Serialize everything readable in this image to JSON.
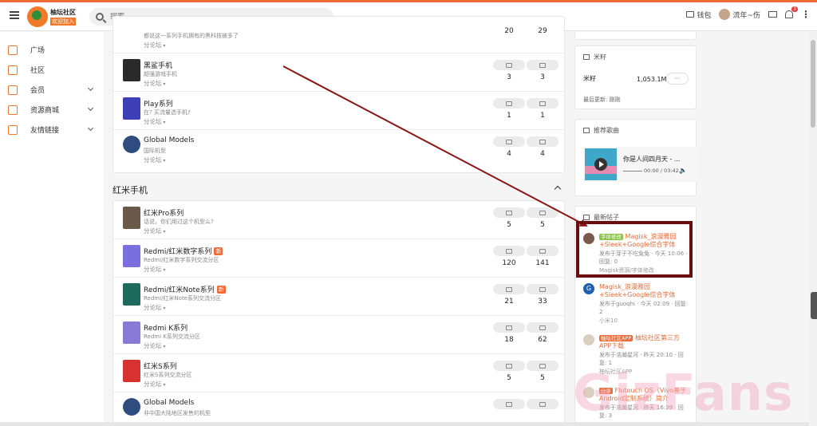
{
  "header": {
    "logo_title": "柚坛社区",
    "logo_sub": "欢迎加入",
    "search_placeholder": "搜索...",
    "wallet_label": "钱包",
    "user_name": "流年~伤",
    "bell_count": "3"
  },
  "sidebar": {
    "items": [
      {
        "label": "广场"
      },
      {
        "label": "社区"
      },
      {
        "label": "会员"
      },
      {
        "label": "资源商城"
      },
      {
        "label": "友情链接"
      }
    ]
  },
  "black_shark_section": {
    "top_partial": {
      "desc": "都说这一系列手机拥有的黑科技被多了",
      "sub": "分论坛",
      "topics": "20",
      "posts": "29"
    },
    "rows": [
      {
        "title": "黑鲨手机",
        "desc": "超强游戏手机",
        "sub": "分论坛",
        "topics": "3",
        "posts": "3",
        "thumb_color": "#2a2a2a"
      },
      {
        "title": "Play系列",
        "desc": "在? 买流量选手机?",
        "sub": "分论坛",
        "topics": "1",
        "posts": "1",
        "thumb_color": "#3d3fb8"
      },
      {
        "title": "Global Models",
        "desc": "国际机型",
        "sub": "分论坛",
        "topics": "4",
        "posts": "4",
        "thumb_color": "#2f4c80"
      }
    ]
  },
  "redmi_section": {
    "title": "红米手机",
    "rows": [
      {
        "title": "红米Pro系列",
        "new": "",
        "desc": "话说，你们用过这个机型么?",
        "sub": "分论坛",
        "topics": "5",
        "posts": "5",
        "thumb_color": "#6b5a4a"
      },
      {
        "title": "Redmi/红米数字系列",
        "new": "新",
        "desc": "Redmi/红米数字系列交流分区",
        "sub": "分论坛",
        "topics": "120",
        "posts": "141",
        "thumb_color": "#7b6fe0"
      },
      {
        "title": "Redmi/红米Note系列",
        "new": "新",
        "desc": "Redmi/红米Note系列交流分区",
        "sub": "分论坛",
        "topics": "21",
        "posts": "33",
        "thumb_color": "#1e6a5c"
      },
      {
        "title": "Redmi K系列",
        "new": "",
        "desc": "Redmi K系列交流分区",
        "sub": "分论坛",
        "topics": "18",
        "posts": "62",
        "thumb_color": "#8a7ad8"
      },
      {
        "title": "红米S系列",
        "new": "",
        "desc": "红米S系列交流分区",
        "sub": "分论坛",
        "topics": "5",
        "posts": "5",
        "thumb_color": "#d93030"
      },
      {
        "title": "Global Models",
        "new": "",
        "desc": "非中国大陆地区发售的机型",
        "sub": "分论坛",
        "topics": "",
        "posts": "",
        "thumb_color": "#2f4c80"
      }
    ]
  },
  "rice_widget": {
    "title": "米籽",
    "label": "米籽",
    "value": "1,053.1M",
    "dots": "···",
    "updated": "最后更新: 刚刚"
  },
  "music_widget": {
    "title": "推荐歌曲",
    "song": "你是人间四月天 - ...",
    "time": "00:00 / 03:42"
  },
  "posts_widget": {
    "title": "最新帖子",
    "posts": [
      {
        "tag": "字体修改",
        "tag_color": "green",
        "title": "Magisk_浪漫雅园+Sleek+Google综合字体",
        "meta": "发布于芽子不吃兔兔 · 今天 10:06 · 回复: 0",
        "cat": "Magisk资源/字体修改",
        "avatar_color": "#7a5a4a"
      },
      {
        "tag": "",
        "tag_color": "",
        "title": "Magisk_浪漫雅园+Sleek+Google综合字体",
        "meta": "发布于guoqhi · 今天 02:09 · 回复: 2",
        "cat": "小米10",
        "avatar_color": "#1e5fb0",
        "avatar_letter": "G"
      },
      {
        "tag": "柚坛社区APP",
        "tag_color": "red",
        "title": "柚坛社区第三方APP下载",
        "meta": "发布于浩瀚星河 · 昨天 20:10 · 回复: 1",
        "cat": "柚坛社区APP",
        "avatar_color": "#d8cfc0"
      },
      {
        "tag": "分享",
        "tag_color": "red",
        "title": "Flutouch OS（Vivo基于Android定制系统）简介",
        "meta": "发布于浩瀚星河 · 昨天 16:39 · 回复: 3",
        "cat": "",
        "avatar_color": "#d8cfc0"
      }
    ]
  },
  "watermark": "GizFans",
  "colors": {
    "accent": "#f06a35",
    "highlight_box": "#6b0d0d",
    "arrow": "#8b1515"
  }
}
